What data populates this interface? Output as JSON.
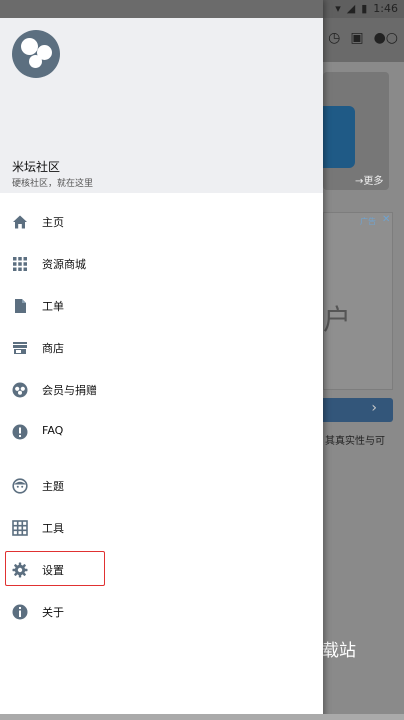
{
  "status_bar": {
    "time": "1:46"
  },
  "drawer": {
    "app_name": "米坛社区",
    "tagline": "硬核社区，就在这里",
    "menu": [
      {
        "label": "主页",
        "icon": "home-icon"
      },
      {
        "label": "资源商城",
        "icon": "grid-icon"
      },
      {
        "label": "工单",
        "icon": "document-icon"
      },
      {
        "label": "商店",
        "icon": "store-icon"
      },
      {
        "label": "会员与捐赠",
        "icon": "membership-icon"
      },
      {
        "label": "FAQ",
        "icon": "alert-circle-icon"
      },
      {
        "label": "主题",
        "icon": "face-icon"
      },
      {
        "label": "工具",
        "icon": "table-icon"
      },
      {
        "label": "设置",
        "icon": "gear-icon",
        "highlighted": true
      },
      {
        "label": "关于",
        "icon": "info-icon"
      }
    ]
  },
  "background": {
    "more_link": "→更多",
    "ad_tag": "广告",
    "ad_close": "✕",
    "ad_big_char": "户",
    "ad_note": "其真实性与可",
    "watermark": "载站"
  },
  "colors": {
    "icon": "#5c6f80",
    "highlight": "#e03131",
    "header_bg": "#eeeff2"
  }
}
